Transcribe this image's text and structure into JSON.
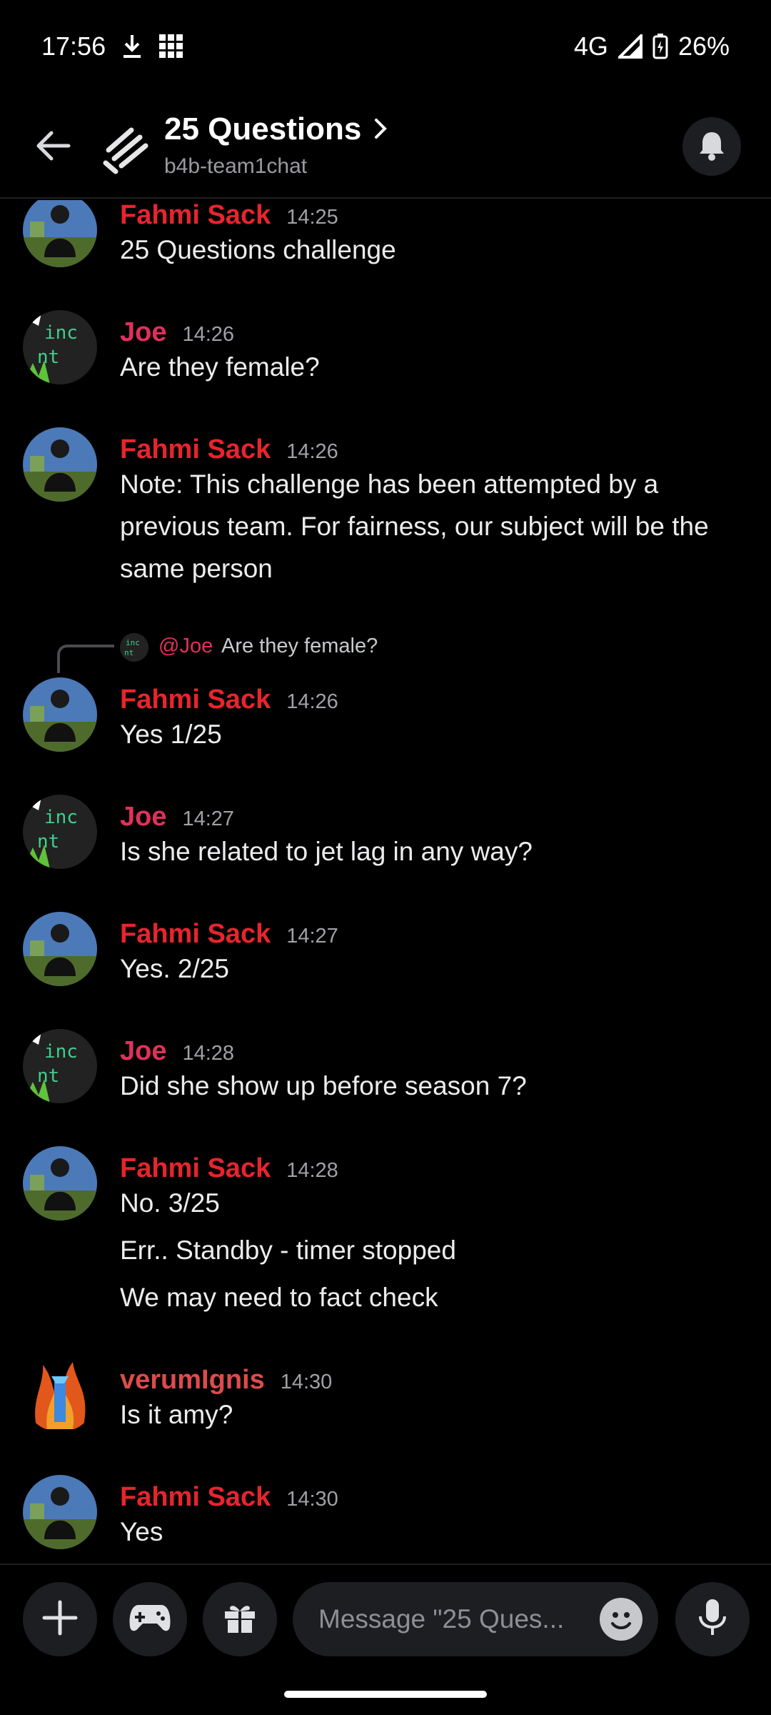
{
  "status_bar": {
    "time": "17:56",
    "network": "4G",
    "battery": "26%",
    "icons": [
      "download-icon",
      "app-grid-icon",
      "signal-icon",
      "battery-icon"
    ]
  },
  "header": {
    "title": "25 Questions",
    "subtitle": "b4b-team1chat"
  },
  "messages": [
    {
      "author": "Fahmi Sack",
      "time": "14:25",
      "lines": [
        "25 Questions challenge"
      ]
    },
    {
      "author": "Joe",
      "time": "14:26",
      "lines": [
        "Are they female?"
      ]
    },
    {
      "author": "Fahmi Sack",
      "time": "14:26",
      "lines": [
        "Note: This challenge has been attempted by a previous team. For fairness, our subject will be the same person"
      ]
    },
    {
      "author": "Fahmi Sack",
      "time": "14:26",
      "lines": [
        "Yes 1/25"
      ],
      "reply": {
        "mention": "@Joe",
        "text": "Are they female?"
      }
    },
    {
      "author": "Joe",
      "time": "14:27",
      "lines": [
        "Is she related to jet lag in any way?"
      ]
    },
    {
      "author": "Fahmi Sack",
      "time": "14:27",
      "lines": [
        "Yes. 2/25"
      ]
    },
    {
      "author": "Joe",
      "time": "14:28",
      "lines": [
        "Did she show up before season 7?"
      ]
    },
    {
      "author": "Fahmi Sack",
      "time": "14:28",
      "lines": [
        "No. 3/25",
        "Err.. Standby - timer stopped",
        "We may need to fact check"
      ]
    },
    {
      "author": "verumIgnis",
      "time": "14:30",
      "lines": [
        "Is it amy?"
      ]
    },
    {
      "author": "Fahmi Sack",
      "time": "14:30",
      "lines": [
        "Yes"
      ]
    }
  ],
  "input": {
    "placeholder": "Message \"25 Ques..."
  },
  "colors": {
    "fahmi": "#e8242d",
    "joe": "#e0315a",
    "verum": "#dd4b4b",
    "background": "#000000",
    "surface": "#1d1e22"
  }
}
